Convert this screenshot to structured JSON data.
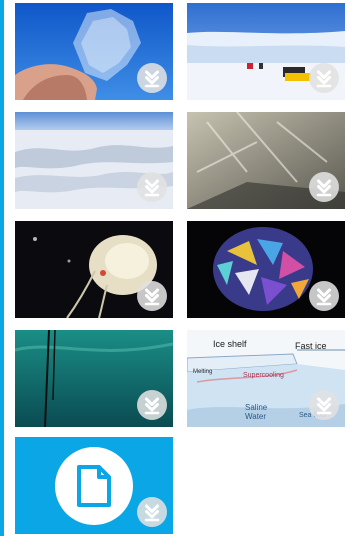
{
  "gallery": {
    "accent_color": "#0aa6e6",
    "download_icon": "download-icon",
    "tiles": [
      {
        "name": "tile-ice-crystal-hand"
      },
      {
        "name": "tile-ice-shelf-snowmobiles"
      },
      {
        "name": "tile-snow-sastrugi"
      },
      {
        "name": "tile-sea-ice-close-up"
      },
      {
        "name": "tile-jellyfish-creature"
      },
      {
        "name": "tile-ice-crystals-polarized"
      },
      {
        "name": "tile-underwater-ice"
      },
      {
        "name": "tile-ice-shelf-diagram"
      },
      {
        "name": "tile-file-placeholder",
        "icon": "file-icon"
      }
    ],
    "diagram_labels": {
      "fast_ice": "Fast ice",
      "ice_shelf": "Ice shelf",
      "melting": "Melting",
      "supercooling": "Supercooling",
      "saline_water": "Saline\nWater",
      "sea_floor": "Sea floor"
    }
  }
}
